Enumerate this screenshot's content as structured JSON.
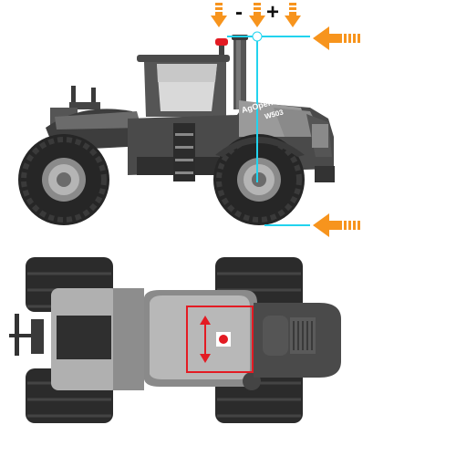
{
  "controls": {
    "decrease_label": "-",
    "increase_label": "+"
  },
  "tractor": {
    "brand": "AgOpenGPS",
    "model": "W503"
  },
  "colors": {
    "arrow": "#f7941d",
    "guide_line": "#22d3ee",
    "body_dark": "#4a4a4a",
    "body_mid": "#8a8a8a",
    "body_light": "#b3b3b3",
    "tire": "#2b2b2b",
    "antenna_box": "#e31b23",
    "antenna_dot": "#e31b23"
  },
  "icons": [
    "arrow-down-icon",
    "arrow-left-icon",
    "tractor-side-view",
    "tractor-top-view",
    "antenna-marker",
    "double-arrow-vertical-icon"
  ]
}
